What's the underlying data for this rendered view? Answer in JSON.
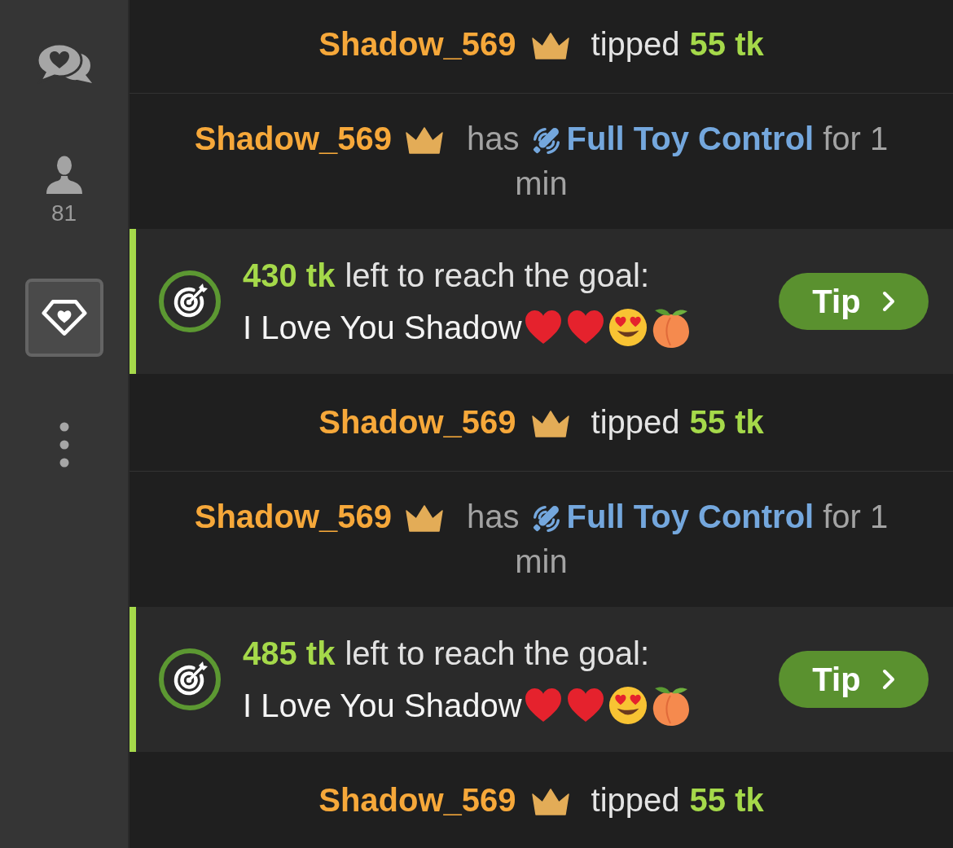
{
  "sidebar": {
    "items": [
      {
        "kind": "chat",
        "selected": false
      },
      {
        "kind": "users",
        "count": "81",
        "selected": false
      },
      {
        "kind": "tokens",
        "selected": true
      },
      {
        "kind": "more",
        "selected": false
      }
    ]
  },
  "messages": [
    {
      "kind": "tip",
      "user": "Shadow_569",
      "verb": "tipped",
      "amount": "55 tk"
    },
    {
      "kind": "toy_control",
      "user": "Shadow_569",
      "verb": "has",
      "feature": "Full Toy Control",
      "duration": "for 1 min"
    },
    {
      "kind": "goal",
      "amount": "430 tk",
      "text": "left to reach the goal:",
      "title": "I Love You Shadow",
      "emojis": [
        {
          "kind": "heart"
        },
        {
          "kind": "heart"
        },
        {
          "kind": "heart_eyes"
        },
        {
          "kind": "peach"
        }
      ],
      "button": "Tip"
    },
    {
      "kind": "tip",
      "user": "Shadow_569",
      "verb": "tipped",
      "amount": "55 tk"
    },
    {
      "kind": "toy_control",
      "user": "Shadow_569",
      "verb": "has",
      "feature": "Full Toy Control",
      "duration": "for 1 min"
    },
    {
      "kind": "goal",
      "amount": "485 tk",
      "text": "left to reach the goal:",
      "title": "I Love You Shadow",
      "emojis": [
        {
          "kind": "heart"
        },
        {
          "kind": "heart"
        },
        {
          "kind": "heart_eyes"
        },
        {
          "kind": "peach"
        }
      ],
      "button": "Tip"
    },
    {
      "kind": "tip",
      "user": "Shadow_569",
      "verb": "tipped",
      "amount": "55 tk"
    }
  ]
}
